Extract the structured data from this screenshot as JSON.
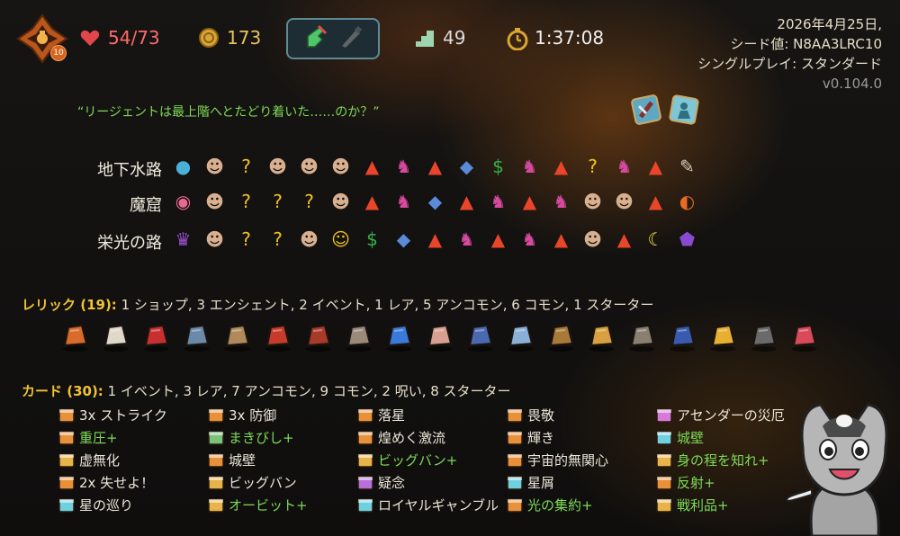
{
  "top_bar": {
    "ascension_level": "10",
    "hp": "54/73",
    "gold": "173",
    "floor": "49",
    "time": "1:37:08",
    "icons": [
      "character-portrait-icon",
      "heart-icon",
      "gold-coin-icon",
      "potion-icon",
      "stairs-icon",
      "stopwatch-icon"
    ]
  },
  "run_info": {
    "date": "2026年4月25日,",
    "seed": "シード値: N8AA3LRC10",
    "mode": "シングルプレイ: スタンダード",
    "version": "v0.104.0"
  },
  "quote": "“リージェントは最上階へとたどり着いた……のか？”",
  "acts": [
    {
      "name": "地下水路",
      "nodes": [
        "ancient-blue",
        "monster",
        "unknown",
        "monster",
        "monster",
        "monster",
        "rest",
        "elite",
        "rest",
        "shop",
        "treasure",
        "elite",
        "rest",
        "unknown",
        "elite",
        "rest",
        "boss-scroll"
      ]
    },
    {
      "name": "魔窟",
      "nodes": [
        "ancient-eye",
        "monster",
        "unknown",
        "unknown",
        "unknown",
        "monster",
        "rest",
        "elite",
        "shop",
        "rest",
        "elite",
        "rest",
        "elite",
        "monster",
        "monster",
        "rest",
        "boss-orange"
      ]
    },
    {
      "name": "栄光の路",
      "nodes": [
        "ancient-purple",
        "monster",
        "unknown-fight",
        "unknown",
        "monster",
        "event-yellow",
        "treasure",
        "shop",
        "rest",
        "elite",
        "rest",
        "elite",
        "rest",
        "monster",
        "rest",
        "boss-yellow",
        "boss-purple"
      ]
    }
  ],
  "relics": {
    "label": "レリック (19):",
    "summary": "1 ショップ, 3 エンシェント, 2 イベント, 1 レア, 5 アンコモン, 6 コモン, 1 スターター",
    "items": [
      "crystal-relic",
      "bag-relic",
      "potion-flask-relic",
      "rat-relic",
      "backpack-relic",
      "toolbox-relic",
      "chest-relic",
      "anvil-relic",
      "lightning-relic",
      "teacup-relic",
      "book-relic",
      "map-relic",
      "wooden-idol-relic",
      "pyramid-relic",
      "stone-tablet-relic",
      "anchor-relic",
      "banana-relic",
      "iron-ball-relic",
      "lipstick-relic"
    ]
  },
  "cards": {
    "label": "カード (30):",
    "summary": "1 イベント, 3 レア, 7 アンコモン, 9 コモン, 2 呪い, 8 スターター",
    "columns": [
      [
        {
          "name": "3x ストライク",
          "upgraded": false,
          "color": "#e8913a"
        },
        {
          "name": "重圧+",
          "upgraded": true,
          "color": "#e8913a"
        },
        {
          "name": "虚無化",
          "upgraded": false,
          "color": "#e8b34a"
        },
        {
          "name": "2x 失せよ！",
          "upgraded": false,
          "color": "#e8913a"
        },
        {
          "name": "星の巡り",
          "upgraded": false,
          "color": "#6fd0e0"
        }
      ],
      [
        {
          "name": "3x 防御",
          "upgraded": false,
          "color": "#e8913a"
        },
        {
          "name": "まきびし+",
          "upgraded": true,
          "color": "#7ac27a"
        },
        {
          "name": "城壁",
          "upgraded": false,
          "color": "#e8913a"
        },
        {
          "name": "ビッグバン",
          "upgraded": false,
          "color": "#e8b34a"
        },
        {
          "name": "オービット+",
          "upgraded": true,
          "color": "#e8b34a"
        }
      ],
      [
        {
          "name": "落星",
          "upgraded": false,
          "color": "#e8913a"
        },
        {
          "name": "煌めく激流",
          "upgraded": false,
          "color": "#e8913a"
        },
        {
          "name": "ビッグバン+",
          "upgraded": true,
          "color": "#e8b34a"
        },
        {
          "name": "疑念",
          "upgraded": false,
          "color": "#b870d8"
        },
        {
          "name": "ロイヤルギャンブル",
          "upgraded": false,
          "color": "#6fd0e0"
        }
      ],
      [
        {
          "name": "畏敬",
          "upgraded": false,
          "color": "#e8913a"
        },
        {
          "name": "輝き",
          "upgraded": false,
          "color": "#e8913a"
        },
        {
          "name": "宇宙的無関心",
          "upgraded": false,
          "color": "#e8913a"
        },
        {
          "name": "星屑",
          "upgraded": false,
          "color": "#6fd0e0"
        },
        {
          "name": "光の集約+",
          "upgraded": true,
          "color": "#e8913a"
        }
      ],
      [
        {
          "name": "アセンダーの災厄",
          "upgraded": false,
          "color": "#d87ad8"
        },
        {
          "name": "城壁",
          "upgraded": true,
          "color": "#6fd0e0"
        },
        {
          "name": "身の程を知れ+",
          "upgraded": true,
          "color": "#e8b34a"
        },
        {
          "name": "反射+",
          "upgraded": true,
          "color": "#e8913a"
        },
        {
          "name": "戦利品+",
          "upgraded": true,
          "color": "#e8b34a"
        }
      ]
    ]
  },
  "colors": {
    "hp": "#ff6a6a",
    "gold": "#e8c35a",
    "upgraded_card": "#7ed957",
    "section_header": "#f1c232",
    "quote": "#7ed957"
  }
}
